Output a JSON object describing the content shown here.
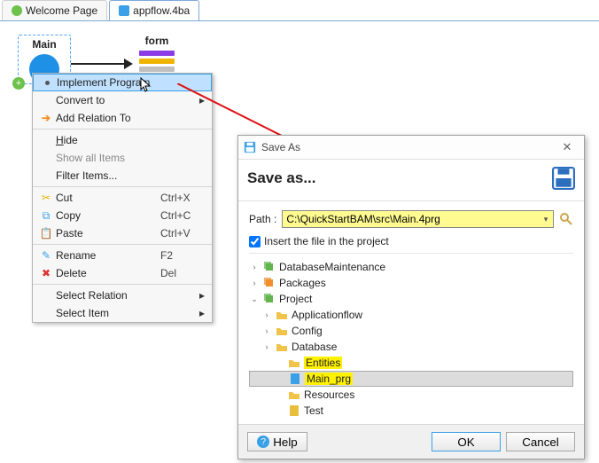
{
  "tabs": [
    {
      "label": "Welcome Page",
      "active": false
    },
    {
      "label": "appflow.4ba",
      "active": true
    }
  ],
  "nodes": {
    "main": {
      "label": "Main"
    },
    "form": {
      "label": "form"
    }
  },
  "context_menu": {
    "items": [
      {
        "label": "Implement Program",
        "icon": "bullet",
        "highlight": true
      },
      {
        "label": "Convert to",
        "submenu": true
      },
      {
        "label": "Add Relation To",
        "icon": "arrow-orange"
      }
    ],
    "group2": [
      {
        "label": "Hide",
        "underline": "H"
      },
      {
        "label": "Show all Items",
        "disabled": true
      },
      {
        "label": "Filter Items..."
      }
    ],
    "group3": [
      {
        "label": "Cut",
        "shortcut": "Ctrl+X",
        "icon": "cut"
      },
      {
        "label": "Copy",
        "shortcut": "Ctrl+C",
        "icon": "copy"
      },
      {
        "label": "Paste",
        "shortcut": "Ctrl+V",
        "icon": "paste"
      }
    ],
    "group4": [
      {
        "label": "Rename",
        "shortcut": "F2",
        "icon": "rename"
      },
      {
        "label": "Delete",
        "shortcut": "Del",
        "icon": "delete"
      }
    ],
    "group5": [
      {
        "label": "Select Relation",
        "submenu": true
      },
      {
        "label": "Select Item",
        "submenu": true
      }
    ]
  },
  "dialog": {
    "title": "Save As",
    "heading": "Save as...",
    "path_label": "Path :",
    "path_value": "C:\\QuickStartBAM\\src\\Main.4prg",
    "insert_label": "Insert the file in the project",
    "insert_checked": true,
    "tree": {
      "root": [
        {
          "label": "DatabaseMaintenance",
          "icon": "pkg-g",
          "twist": ">"
        },
        {
          "label": "Packages",
          "icon": "pkg-o",
          "twist": ">"
        },
        {
          "label": "Project",
          "icon": "pkg-g",
          "twist": "v",
          "children": [
            {
              "label": "Applicationflow",
              "icon": "fold",
              "twist": ">"
            },
            {
              "label": "Config",
              "icon": "fold",
              "twist": ">"
            },
            {
              "label": "Database",
              "icon": "fold",
              "twist": ">"
            },
            {
              "label": "Entities",
              "icon": "fold",
              "highlight": true
            },
            {
              "label": "Main_prg",
              "icon": "file",
              "selected": true,
              "highlight": true
            },
            {
              "label": "Resources",
              "icon": "fold"
            },
            {
              "label": "Test",
              "icon": "file-y"
            }
          ]
        }
      ]
    },
    "buttons": {
      "help": "Help",
      "ok": "OK",
      "cancel": "Cancel"
    }
  }
}
